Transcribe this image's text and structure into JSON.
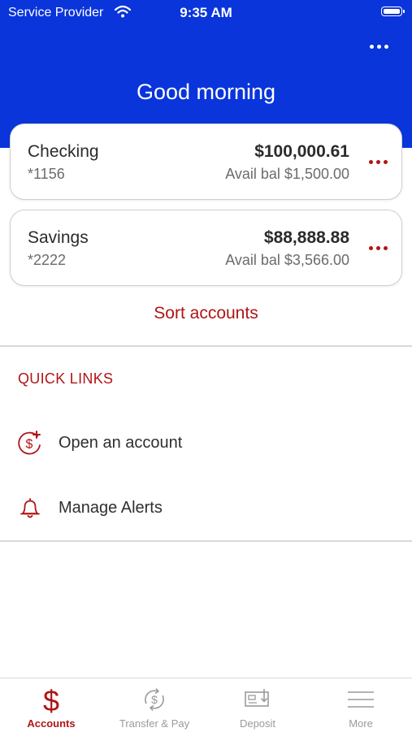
{
  "status_bar": {
    "carrier": "Service Provider",
    "time": "9:35 AM"
  },
  "header": {
    "greeting": "Good morning"
  },
  "accounts": [
    {
      "name": "Checking",
      "number": "*1156",
      "balance": "$100,000.61",
      "available": "Avail bal $1,500.00"
    },
    {
      "name": "Savings",
      "number": "*2222",
      "balance": "$88,888.88",
      "available": "Avail bal $3,566.00"
    }
  ],
  "sort_label": "Sort accounts",
  "quick_links": {
    "title": "QUICK LINKS",
    "items": [
      {
        "label": "Open an account",
        "icon": "open-account-icon"
      },
      {
        "label": "Manage Alerts",
        "icon": "bell-icon"
      }
    ]
  },
  "tabs": [
    {
      "label": "Accounts",
      "icon": "dollar-icon",
      "active": true
    },
    {
      "label": "Transfer & Pay",
      "icon": "transfer-icon",
      "active": false
    },
    {
      "label": "Deposit",
      "icon": "check-deposit-icon",
      "active": false
    },
    {
      "label": "More",
      "icon": "menu-icon",
      "active": false
    }
  ],
  "colors": {
    "header_blue": "#0a35db",
    "accent_red": "#b01516",
    "tab_inactive": "#9a9a9a"
  }
}
